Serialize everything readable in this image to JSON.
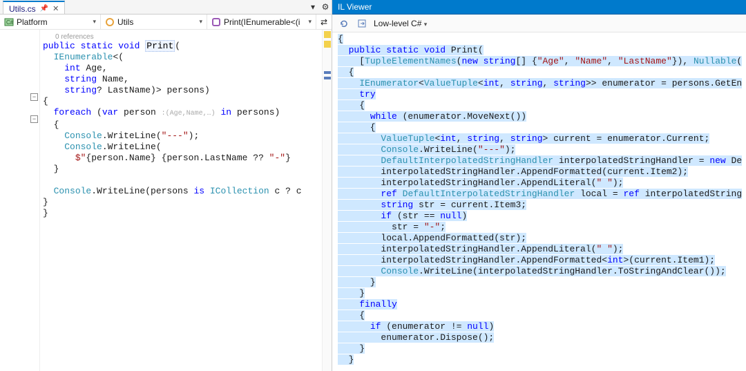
{
  "left": {
    "tab": {
      "title": "Utils.cs",
      "pin_icon": "📌",
      "close_icon": "✕",
      "dropdown_icon": "▾",
      "menu_icon": "⚙"
    },
    "nav": {
      "project": "Platform",
      "class": "Utils",
      "member": "Print(IEnumerable<(i",
      "tool_icon": "⇄"
    },
    "codelens": "0 references",
    "code_html": "<span class='kw'>public</span> <span class='kw'>static</span> <span class='kw'>void</span> <span class='methodname'>Print</span>(\n  <span class='type'>IEnumerable</span>&lt;(\n    <span class='kw'>int</span> Age,\n    <span class='kw'>string</span> Name,\n    <span class='kw'>string</span>? LastName)&gt; persons)\n{\n  <span class='kw'>foreach</span> (<span class='kw'>var</span> person <span class='param-hint'>:(Age,Name,…)</span> <span class='kw'>in</span> persons)\n  {\n    <span class='type'>Console</span>.WriteLine(<span class='str'>\"---\"</span>);\n    <span class='type'>Console</span>.WriteLine(\n      <span class='str'>$\"</span>{person.Name} {person.LastName ?? <span class='str'>\"-\"</span>}\n  }\n\n  <span class='type'>Console</span>.WriteLine(persons <span class='kw'>is</span> <span class='type'>ICollection</span> c ? c\n}\n}"
  },
  "right": {
    "title": "IL Viewer",
    "level_label": "Low-level C#",
    "code_html": "{\n  <span class='kw'>public</span> <span class='kw'>static</span> <span class='kw'>void</span> Print(\n    [<span class='type'>TupleElementNames</span>(<span class='kw'>new</span> <span class='kw'>string</span>[] {<span class='str'>\"Age\"</span>, <span class='str'>\"Name\"</span>, <span class='str'>\"LastName\"</span>}), <span class='type'>Nullable</span>(\n  {\n    <span class='type'>IEnumerator</span>&lt;<span class='type'>ValueTuple</span>&lt;<span class='kw'>int</span>, <span class='kw'>string</span>, <span class='kw'>string</span>&gt;&gt; enumerator = persons.GetEn\n    <span class='kw'>try</span>\n    {\n      <span class='kw'>while</span> (enumerator.MoveNext())\n      {\n        <span class='type'>ValueTuple</span>&lt;<span class='kw'>int</span>, <span class='kw'>string</span>, <span class='kw'>string</span>&gt; current = enumerator.Current;\n        <span class='type'>Console</span>.WriteLine(<span class='str'>\"---\"</span>);\n        <span class='type'>DefaultInterpolatedStringHandler</span> interpolatedStringHandler = <span class='kw'>new</span> De\n        interpolatedStringHandler.AppendFormatted(current.Item2);\n        interpolatedStringHandler.AppendLiteral(<span class='str'>\" \"</span>);\n        <span class='kw'>ref</span> <span class='type'>DefaultInterpolatedStringHandler</span> local = <span class='kw'>ref</span> interpolatedString\n        <span class='kw'>string</span> str = current.Item3;\n        <span class='kw'>if</span> (str == <span class='kw'>null</span>)\n          str = <span class='str'>\"-\"</span>;\n        local.AppendFormatted(str);\n        interpolatedStringHandler.AppendLiteral(<span class='str'>\" \"</span>);\n        interpolatedStringHandler.AppendFormatted&lt;<span class='kw'>int</span>&gt;(current.Item1);\n        <span class='type'>Console</span>.WriteLine(interpolatedStringHandler.ToStringAndClear());\n      }\n    }\n    <span class='kw'>finally</span>\n    {\n      <span class='kw'>if</span> (enumerator != <span class='kw'>null</span>)\n        enumerator.Dispose();\n    }\n  }"
  }
}
